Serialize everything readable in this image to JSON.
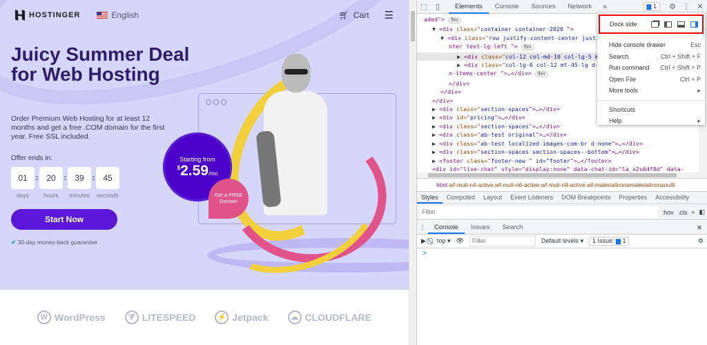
{
  "site": {
    "brand": "HOSTINGER",
    "language": "English",
    "cart": "Cart",
    "headline": "Juicy Summer Deal for Web Hosting",
    "subtext": "Order Premium Web Hosting for at least 12 months and get a free .COM domain for the first year. Free SSL included.",
    "offer_label": "Offer ends in:",
    "timer": [
      {
        "value": "01",
        "label": "days"
      },
      {
        "value": "20",
        "label": "hours"
      },
      {
        "value": "39",
        "label": "minutes"
      },
      {
        "value": "45",
        "label": "seconds"
      }
    ],
    "cta": "Start Now",
    "guarantee": "30-day money-back guarantee",
    "price_label": "Starting from",
    "currency": "$",
    "price": "2.59",
    "per": "/mo",
    "free_domain": "Get a FREE Domain",
    "partners": [
      "WordPress",
      "LITESPEED",
      "Jetpack",
      "CLOUDFLARE"
    ]
  },
  "devtools": {
    "tabs": [
      "Elements",
      "Console",
      "Sources",
      "Network"
    ],
    "issues_count": "1",
    "dom_lines": [
      {
        "indent": 0,
        "text": "aded\">",
        "flex": true
      },
      {
        "indent": 1,
        "arrow": "▼",
        "tag": "div",
        "cls": "container container-2020 "
      },
      {
        "indent": 2,
        "arrow": "▼",
        "tag": "div",
        "cls": "row justify-content-center justi"
      },
      {
        "indent": 3,
        "raw": "nter text-lg-left   \">",
        "flex": true
      },
      {
        "indent": 4,
        "arrow": "▶",
        "tag": "div",
        "cls": "col-12 col-md-10 col-lg-5  mb-",
        "sel": true
      },
      {
        "indent": 4,
        "arrow": "▶",
        "tag": "div",
        "cls": "col-lg-6 col-12 mt-45-lg d-fle"
      },
      {
        "indent": 3,
        "raw": "n-items-center \">…</div>",
        "flex": true
      },
      {
        "indent": 3,
        "raw": "</div>"
      },
      {
        "indent": 2,
        "raw": "</div>"
      },
      {
        "indent": 1,
        "raw": "</div>"
      },
      {
        "indent": 1,
        "arrow": "▶",
        "tag": "div",
        "cls": "section-spaces",
        "tail": "…</div>"
      },
      {
        "indent": 1,
        "arrow": "▶",
        "tag": "div",
        "attr": "id",
        "cls": "pricing",
        "tail": "…</div>"
      },
      {
        "indent": 1,
        "arrow": "▶",
        "tag": "div",
        "cls": "section-spaces",
        "tail": "…</div>"
      },
      {
        "indent": 1,
        "arrow": "▶",
        "tag": "div",
        "cls": "ab-test original",
        "tail": "…</div>"
      },
      {
        "indent": 1,
        "arrow": "▶",
        "tag": "div",
        "cls": "ab-test localized-images-com-br d-none",
        "tail": "…</div>"
      },
      {
        "indent": 1,
        "arrow": "▶",
        "tag": "div",
        "cls": "section-spaces  section-spaces--bottom",
        "tail": "…</div>"
      },
      {
        "indent": 1,
        "arrow": "▶",
        "tag": "footer",
        "cls": "footer-new \" id=\"footer",
        "tail": "…</footer>"
      },
      {
        "indent": 1,
        "raw": "<div id=\"live-chat\" style=\"display:none\" data-chat-id=\"la_x2s6df8d\" data-"
      }
    ],
    "breadcrumb_tag": "html",
    "breadcrumb": ".wf-muli-n4-active.wf-muli-n6-active.wf-muli-n8-active.wf-materialiconsmaterialiconsoutli",
    "style_tabs": [
      "Styles",
      "Computed",
      "Layout",
      "Event Listeners",
      "DOM Breakpoints",
      "Properties",
      "Accessibility"
    ],
    "filter_placeholder": "Filter",
    "hov": ":hov",
    "cls": ".cls",
    "drawer_tabs": [
      "Console",
      "Issues",
      "Search"
    ],
    "context": "top",
    "console_filter": "Filter",
    "levels": "Default levels",
    "issues_label": "1 Issue:",
    "prompt": ">",
    "menu": {
      "dock_side": "Dock side",
      "items": [
        {
          "label": "Hide console drawer",
          "key": "Esc"
        },
        {
          "label": "Search",
          "key": "Ctrl + Shift + F"
        },
        {
          "label": "Run command",
          "key": "Ctrl + Shift + P"
        },
        {
          "label": "Open File",
          "key": "Ctrl + P"
        },
        {
          "label": "More tools",
          "key": "▸"
        }
      ],
      "items2": [
        {
          "label": "Shortcuts",
          "key": ""
        },
        {
          "label": "Help",
          "key": "▸"
        }
      ]
    }
  }
}
